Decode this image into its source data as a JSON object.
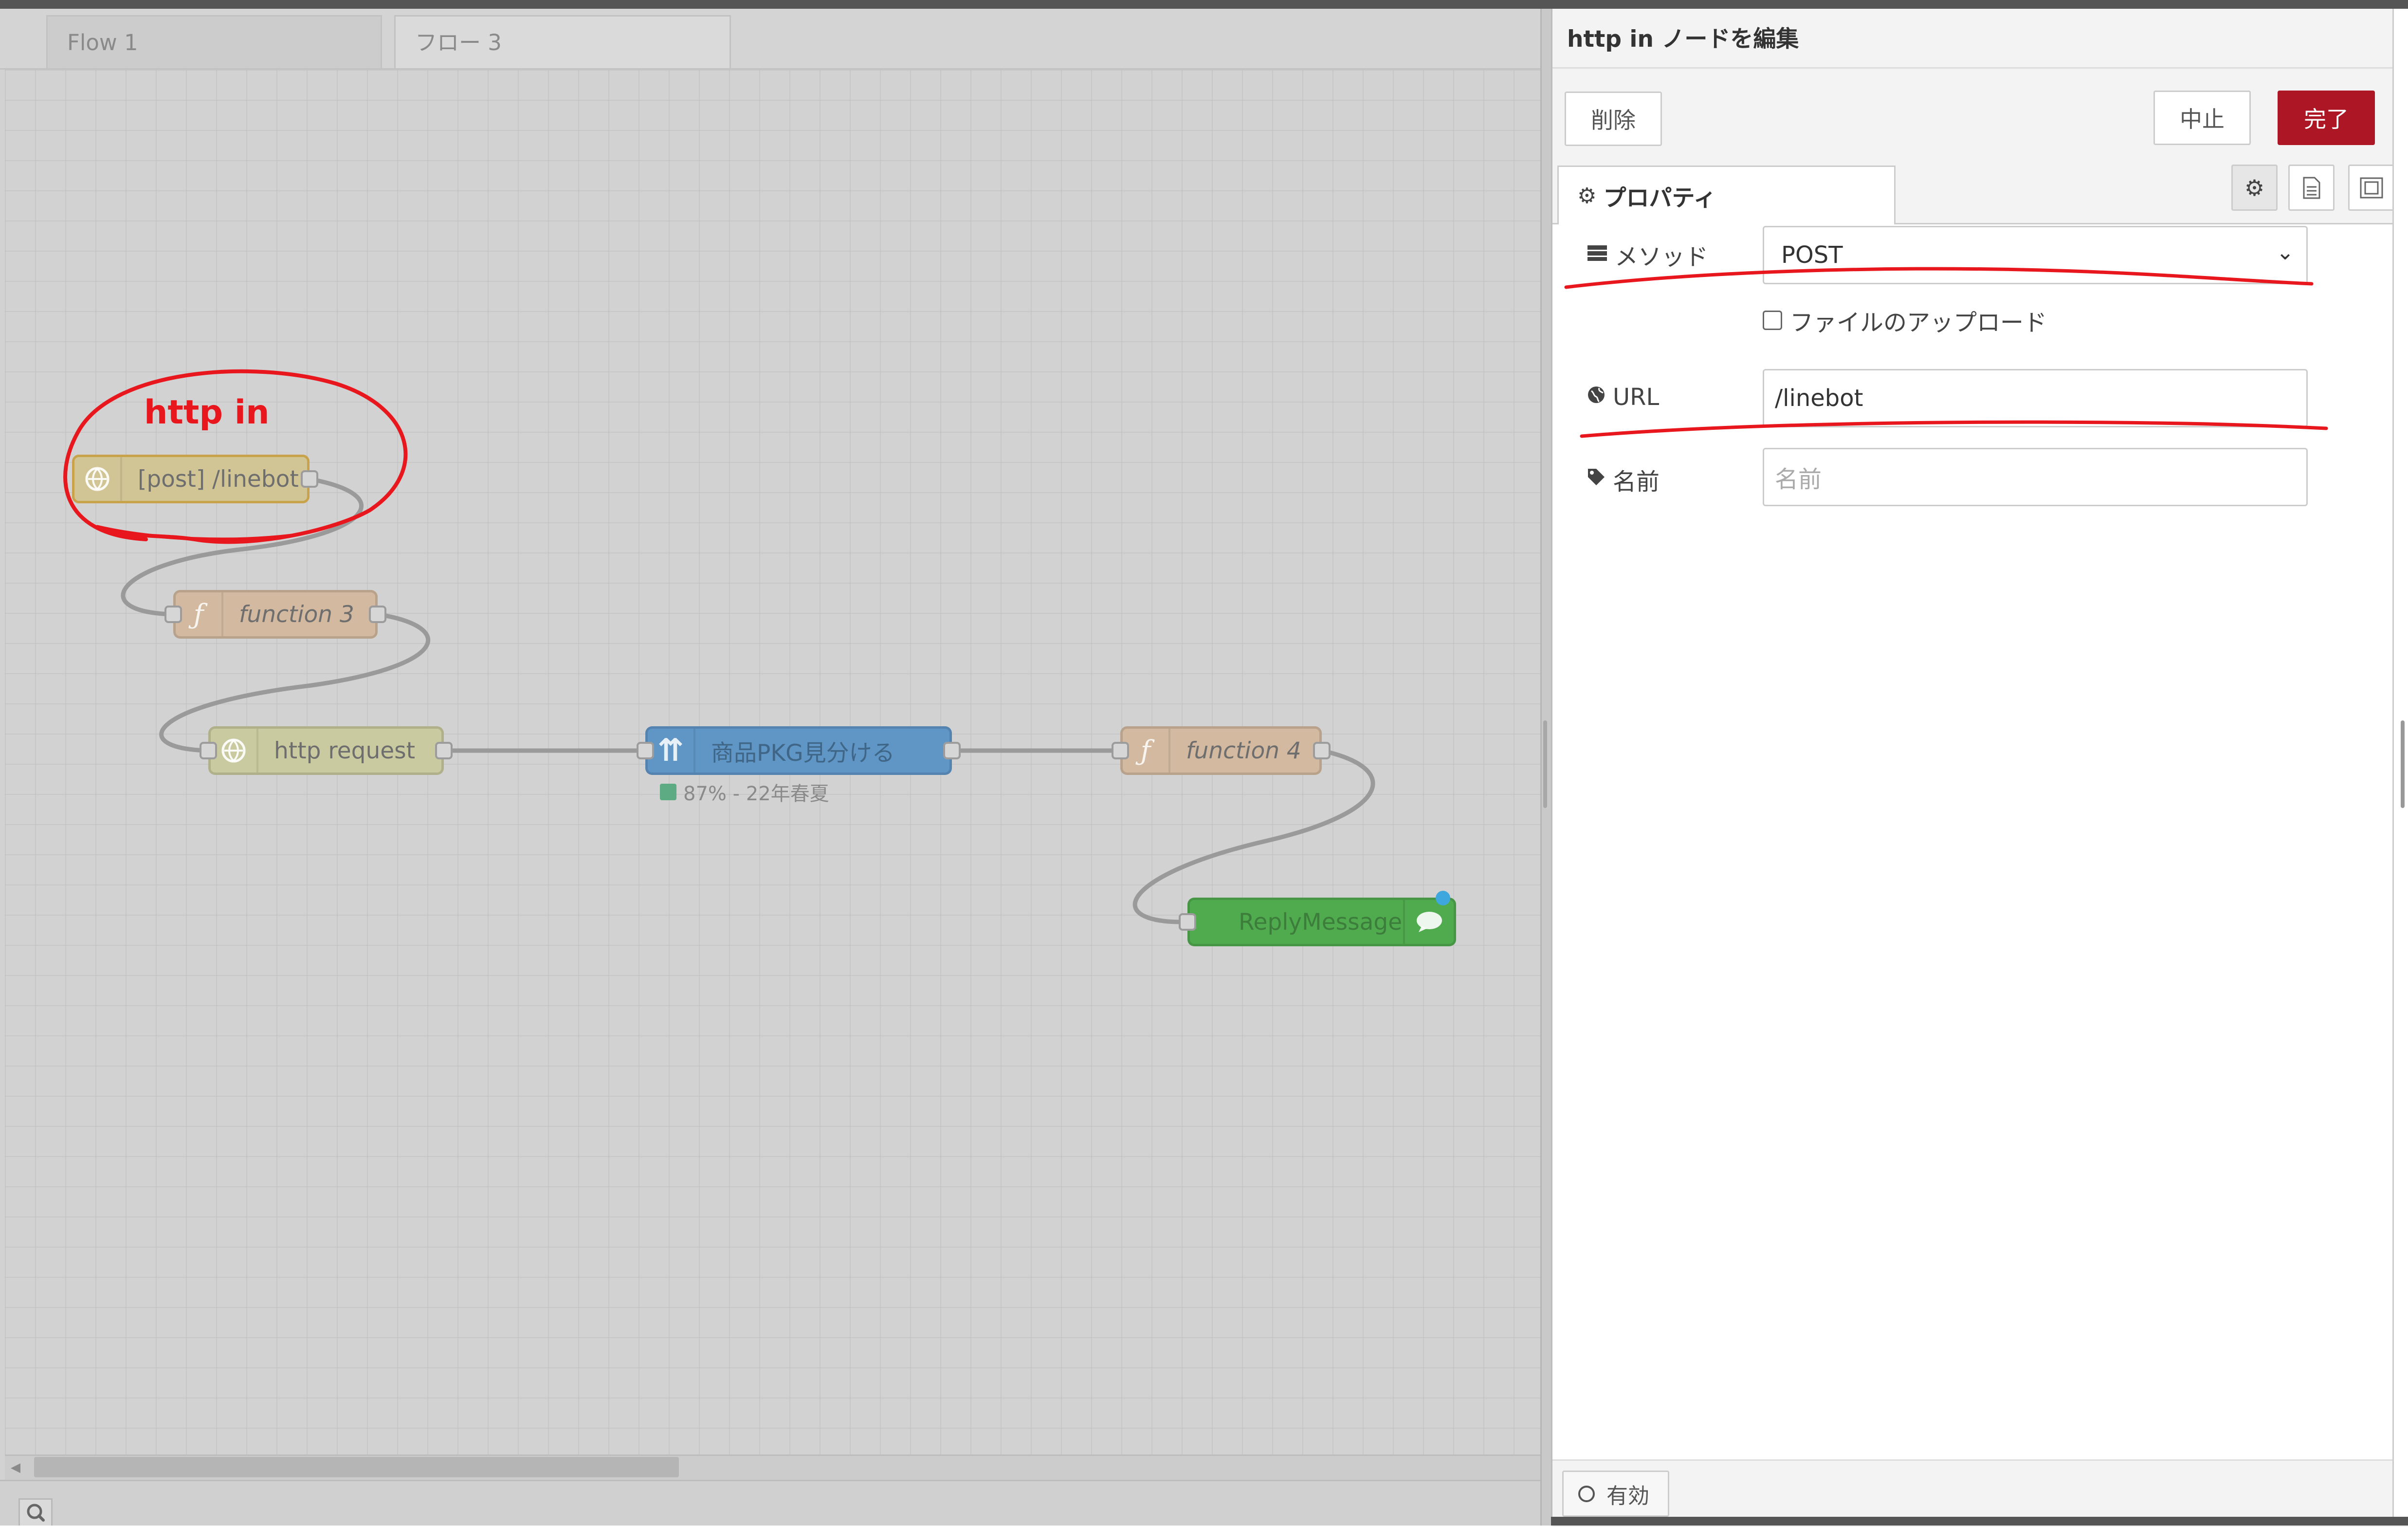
{
  "workspace": {
    "tabs": [
      {
        "label": "Flow 1"
      },
      {
        "label": "フロー 3"
      }
    ],
    "nodes": {
      "http_in": {
        "label": "[post] /linebot",
        "color": "#d1c595"
      },
      "function3": {
        "label": "function 3",
        "color": "#d2b99f"
      },
      "http_request": {
        "label": "http request",
        "color": "#c9ca9f"
      },
      "classifier": {
        "label": "商品PKG見分ける",
        "color": "#5f96c6",
        "status": "87% - 22年春夏"
      },
      "function4": {
        "label": "function 4",
        "color": "#d2b99f"
      },
      "reply": {
        "label": "ReplyMessage",
        "color": "#50ab4f"
      }
    },
    "annotation": {
      "label": "http in",
      "color": "#e8171d"
    }
  },
  "panel": {
    "title": "http in ノードを編集",
    "toolbar": {
      "delete": "削除",
      "cancel": "中止",
      "done": "完了"
    },
    "tab": "プロパティ",
    "form": {
      "method_label": "メソッド",
      "method_value": "POST",
      "upload_label": "ファイルのアップロード",
      "url_label": "URL",
      "url_value": "/linebot",
      "name_label": "名前",
      "name_placeholder": "名前"
    },
    "footer": {
      "enable_label": "有効"
    }
  }
}
